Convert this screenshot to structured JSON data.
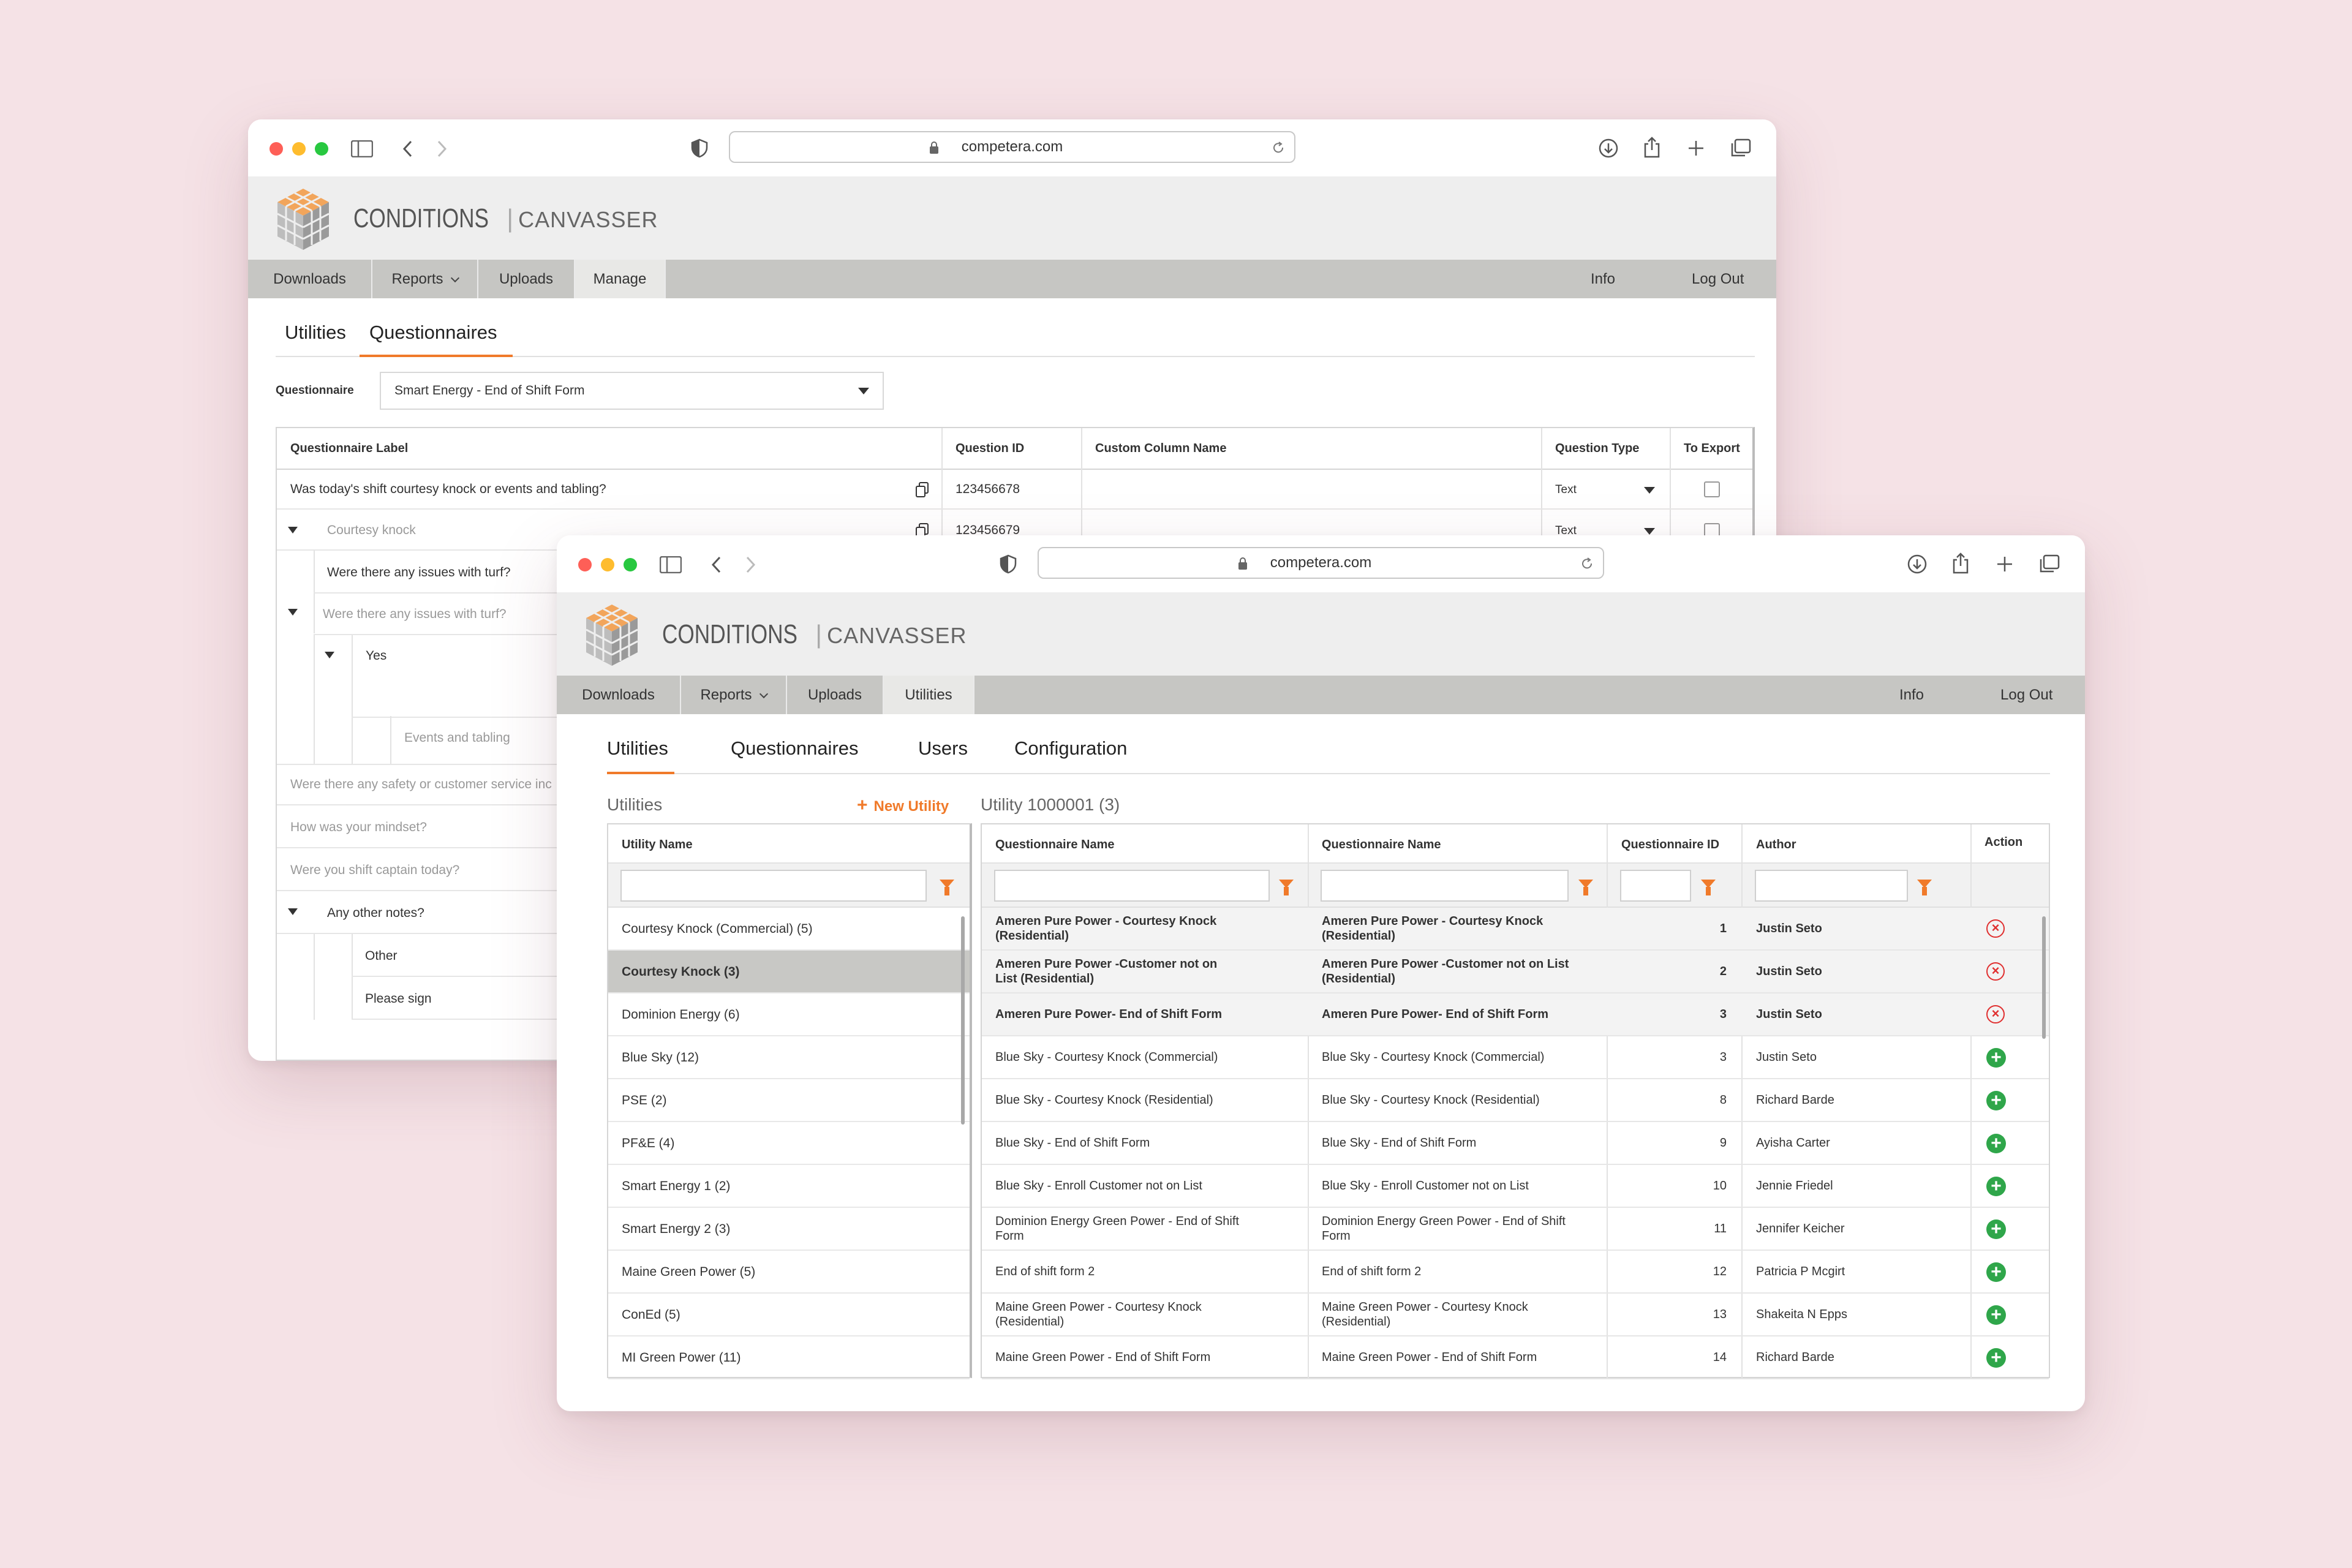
{
  "browser": {
    "url": "competera.com"
  },
  "app": {
    "brand_primary": "CONDITIONS",
    "brand_secondary": "CANVASSER",
    "accent_color": "#f07a2a"
  },
  "back": {
    "nav": {
      "downloads": "Downloads",
      "reports": "Reports",
      "uploads": "Uploads",
      "manage": "Manage",
      "info": "Info",
      "logout": "Log Out"
    },
    "tabs": {
      "utilities": "Utilities",
      "questionnaires": "Questionnaires"
    },
    "questionnaire_label": "Questionnaire",
    "questionnaire_value": "Smart Energy - End of Shift Form",
    "table": {
      "headers": {
        "label": "Questionnaire Label",
        "qid": "Question ID",
        "custom": "Custom Column Name",
        "qtype": "Question Type",
        "export": "To Export"
      },
      "row1": {
        "label": "Was today's shift courtesy knock or events and tabling?",
        "qid": "123456678",
        "qtype": "Text"
      },
      "row2": {
        "label": "Courtesy knock",
        "qid": "123456679",
        "qtype": "Text"
      },
      "tree": {
        "t1": "Were there any issues with turf?",
        "t2": "Were there any issues with turf?",
        "t3": "Yes",
        "t4": "Events and tabling",
        "t5": "Were there any safety or customer service inc",
        "t6": "How was your mindset?",
        "t7": "Were you shift captain today?",
        "t8": "Any other notes?",
        "t9": "Other",
        "t10": "Please sign"
      }
    }
  },
  "front": {
    "nav": {
      "downloads": "Downloads",
      "reports": "Reports",
      "uploads": "Uploads",
      "utilities": "Utilities",
      "info": "Info",
      "logout": "Log Out"
    },
    "tabs": {
      "utilities": "Utilities",
      "questionnaires": "Questionnaires",
      "users": "Users",
      "configuration": "Configuration"
    },
    "utilities_title": "Utilities",
    "new_utility": "New Utility",
    "detail_title": "Utility 1000001 (3)",
    "utility_col": "Utility Name",
    "utilities": [
      "Courtesy Knock (Commercial) (5)",
      "Courtesy Knock (3)",
      "Dominion Energy (6)",
      "Blue Sky (12)",
      "PSE (2)",
      "PF&E (4)",
      "Smart Energy 1 (2)",
      "Smart Energy 2 (3)",
      "Maine Green Power (5)",
      "ConEd (5)",
      "MI Green Power (11)"
    ],
    "table_headers": {
      "qname1": "Questionnaire Name",
      "qname2": "Questionnaire Name",
      "qid": "Questionnaire ID",
      "author": "Author",
      "action": "Action"
    },
    "rows": [
      {
        "n1": "Ameren Pure Power - Courtesy Knock (Residential)",
        "n2": "Ameren Pure Power - Courtesy Knock (Residential)",
        "id": "1",
        "author": "Justin Seto",
        "action": "remove"
      },
      {
        "n1": "Ameren Pure Power -Customer not on List (Residential)",
        "n2": "Ameren Pure Power -Customer not on List (Residential)",
        "id": "2",
        "author": "Justin Seto",
        "action": "remove"
      },
      {
        "n1": "Ameren Pure Power- End of Shift Form",
        "n2": "Ameren Pure Power- End of Shift Form",
        "id": "3",
        "author": "Justin Seto",
        "action": "remove"
      },
      {
        "n1": "Blue Sky - Courtesy Knock (Commercial)",
        "n2": "Blue Sky - Courtesy Knock (Commercial)",
        "id": "3",
        "author": "Justin Seto",
        "action": "add"
      },
      {
        "n1": "Blue Sky - Courtesy Knock (Residential)",
        "n2": "Blue Sky - Courtesy Knock (Residential)",
        "id": "8",
        "author": "Richard Barde",
        "action": "add"
      },
      {
        "n1": "Blue Sky - End of Shift Form",
        "n2": "Blue Sky - End of Shift Form",
        "id": "9",
        "author": "Ayisha Carter",
        "action": "add"
      },
      {
        "n1": "Blue Sky - Enroll Customer not on List",
        "n2": "Blue Sky - Enroll Customer not on List",
        "id": "10",
        "author": "Jennie Friedel",
        "action": "add"
      },
      {
        "n1": "Dominion Energy Green Power - End of Shift Form",
        "n2": "Dominion Energy Green Power - End of Shift Form",
        "id": "11",
        "author": "Jennifer Keicher",
        "action": "add"
      },
      {
        "n1": "End of shift form 2",
        "n2": "End of shift form 2",
        "id": "12",
        "author": "Patricia P Mcgirt",
        "action": "add"
      },
      {
        "n1": "Maine Green Power - Courtesy Knock (Residential)",
        "n2": "Maine Green Power - Courtesy Knock (Residential)",
        "id": "13",
        "author": "Shakeita N Epps",
        "action": "add"
      },
      {
        "n1": "Maine Green Power - End of Shift Form",
        "n2": "Maine Green Power - End of Shift Form",
        "id": "14",
        "author": "Richard Barde",
        "action": "add"
      }
    ]
  }
}
